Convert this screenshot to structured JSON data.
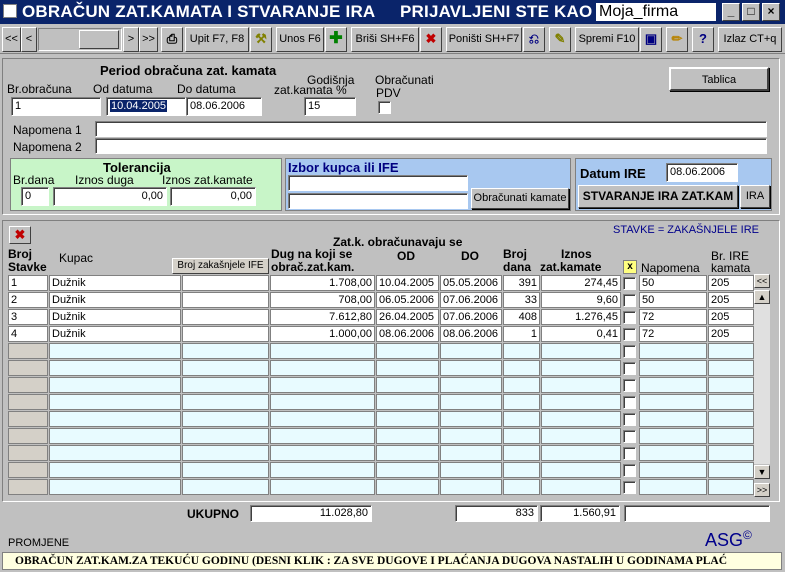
{
  "window": {
    "title": "OBRAČUN ZAT.KAMATA I STVARANJE IRA",
    "user_label": "PRIJAVLJENI STE KAO",
    "firm": "Moja_firma",
    "min": "_",
    "max": "□",
    "close": "×"
  },
  "toolbar": {
    "first": "<<",
    "prev": "<",
    "next": ">",
    "last": ">>",
    "query": "Upit F7, F8",
    "insert": "Unos F6",
    "delete": "Briši SH+F6",
    "cancel": "Poništi SH+F7",
    "save": "Spremi F10",
    "exit": "Izlaz CT+q",
    "help": "?"
  },
  "period": {
    "heading": "Period obračuna zat. kamata",
    "br_label": "Br.obračuna",
    "br_value": "1",
    "od_label": "Od datuma",
    "od_value": "10.04.2005",
    "do_label": "Do datuma",
    "do_value": "08.06.2006",
    "rate_label1": "Godišnja",
    "rate_label2": "zat.kamata %",
    "rate_value": "15",
    "pdv_label1": "Obračunati",
    "pdv_label2": "PDV",
    "tablica": "Tablica"
  },
  "notes": {
    "n1_label": "Napomena 1",
    "n1_value": "",
    "n2_label": "Napomena 2",
    "n2_value": ""
  },
  "tolerance": {
    "heading": "Tolerancija",
    "days_label": "Br.dana",
    "days_value": "0",
    "debt_label": "Iznos duga",
    "debt_value": "0,00",
    "interest_label": "Iznos zat.kamate",
    "interest_value": "0,00"
  },
  "customer": {
    "heading": "Izbor kupca ili IFE",
    "line1": "",
    "line2": "",
    "calc_button": "Obračunati kamate"
  },
  "ira": {
    "date_label": "Datum IRE",
    "date_value": "08.06.2006",
    "create_button": "STVARANJE IRA ZAT.KAM",
    "ira_button": "IRA"
  },
  "grid": {
    "legend": "STAVKE = ZAKAŠNJELE IRE",
    "h_broj1": "Broj",
    "h_broj2": "Stavke",
    "h_kupac": "Kupac",
    "h_ife": "Broj zakašnjele IFE",
    "h_group": "Zat.k. obračunavaju se",
    "h_dug1": "Dug na koji se",
    "h_dug2": "obrač.zat.kam.",
    "h_od": "OD",
    "h_do": "DO",
    "h_dana1": "Broj",
    "h_dana2": "dana",
    "h_iznos1": "Iznos",
    "h_iznos2": "zat.kamate",
    "h_x": "x",
    "h_napomena": "Napomena",
    "h_ire1": "Br. IRE",
    "h_ire2": "kamata",
    "rows": [
      {
        "no": "1",
        "kupac": "Dužnik",
        "ife": "",
        "dug": "1.708,00",
        "od": "10.04.2005",
        "do": "05.05.2006",
        "dana": "391",
        "iznos": "274,45",
        "nap": "50",
        "ire": "205"
      },
      {
        "no": "2",
        "kupac": "Dužnik",
        "ife": "",
        "dug": "708,00",
        "od": "06.05.2006",
        "do": "07.06.2006",
        "dana": "33",
        "iznos": "9,60",
        "nap": "50",
        "ire": "205"
      },
      {
        "no": "3",
        "kupac": "Dužnik",
        "ife": "",
        "dug": "7.612,80",
        "od": "26.04.2005",
        "do": "07.06.2006",
        "dana": "408",
        "iznos": "1.276,45",
        "nap": "72",
        "ire": "205"
      },
      {
        "no": "4",
        "kupac": "Dužnik",
        "ife": "",
        "dug": "1.000,00",
        "od": "08.06.2006",
        "do": "08.06.2006",
        "dana": "1",
        "iznos": "0,41",
        "nap": "72",
        "ire": "205"
      }
    ],
    "empty_rows": 9
  },
  "totals": {
    "label": "UKUPNO",
    "dug": "11.028,80",
    "dana": "833",
    "iznos": "1.560,91"
  },
  "status": {
    "promjene": "PROMJENE",
    "brand": "ASG",
    "brand_mark": "©",
    "hint": "OBRAČUN ZAT.KAM.ZA TEKUĆU GODINU (DESNI KLIK : ZA SVE DUGOVE I PLAĆANJA DUGOVA NASTALIH U GODINAMA PLAĆ"
  },
  "colors": {
    "titlebar": "#0a246a",
    "tolerance_bg": "#c8f5c8",
    "customer_bg": "#a8c8f0",
    "ira_bg": "#a8c8f0",
    "date_highlight": "#0a246a",
    "legend_text": "#00008b"
  }
}
